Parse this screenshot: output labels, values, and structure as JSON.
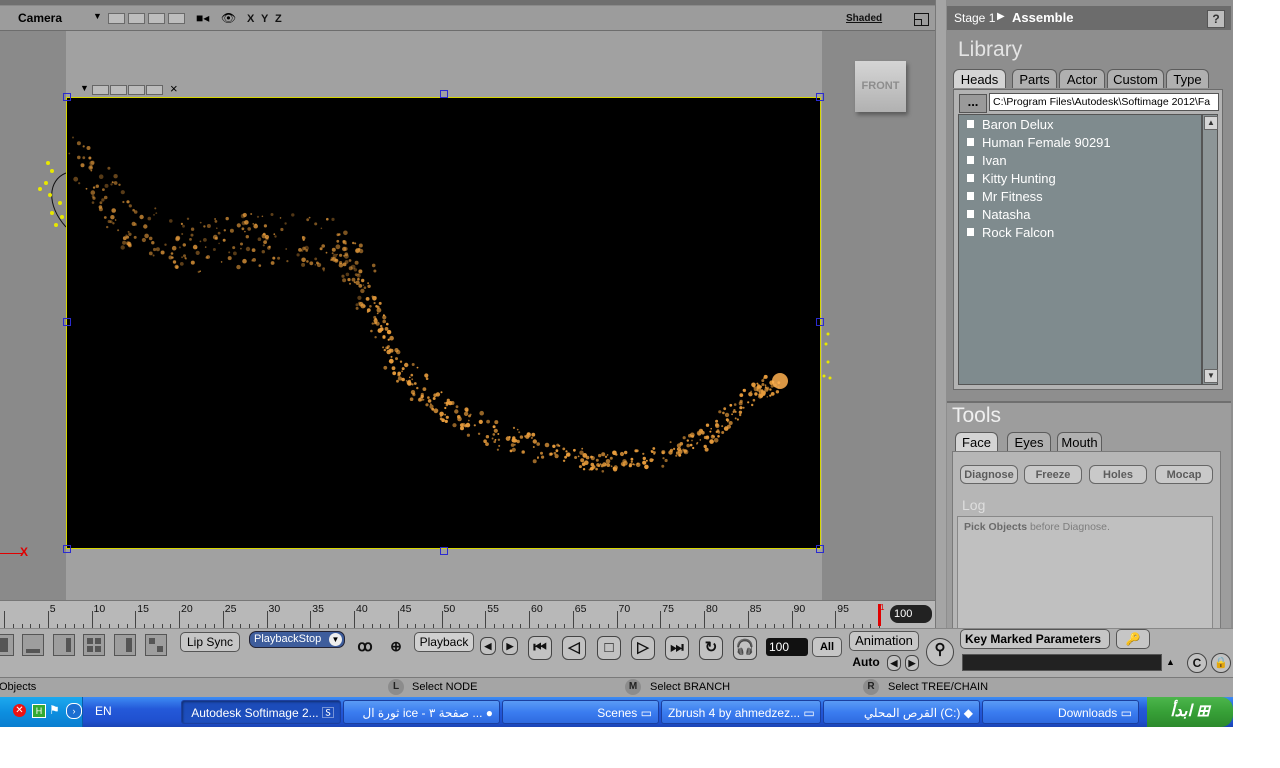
{
  "viewport": {
    "camera_label": "Camera",
    "axes": [
      "X",
      "Y",
      "Z"
    ],
    "display_mode": "Shaded",
    "front_label": "FRONT",
    "axis_x_label": "X"
  },
  "panel": {
    "stage": "Stage 1",
    "stage_name": "Assemble",
    "help": "?",
    "library_title": "Library",
    "library_tabs": [
      "Heads",
      "Parts",
      "Actor",
      "Custom",
      "Type"
    ],
    "path_button": "...",
    "path_value": "C:\\Program Files\\Autodesk\\Softimage 2012\\Fa",
    "characters": [
      "Baron Delux",
      "Human Female 90291",
      "Ivan",
      "Kitty Hunting",
      "Mr Fitness",
      "Natasha",
      "Rock Falcon"
    ],
    "tools_title": "Tools",
    "tools_tabs": [
      "Face",
      "Eyes",
      "Mouth"
    ],
    "tool_buttons": [
      "Diagnose",
      "Freeze",
      "Holes",
      "Mocap"
    ],
    "log_label": "Log",
    "log_bold": "Pick Objects",
    "log_text": " before Diagnose."
  },
  "timeline": {
    "labels": [
      "5",
      "10",
      "15",
      "20",
      "25",
      "30",
      "35",
      "40",
      "45",
      "50",
      "55",
      "60",
      "65",
      "70",
      "75",
      "80",
      "85",
      "90",
      "95"
    ],
    "current_frame": "1",
    "end_frame": "100"
  },
  "playback": {
    "lip_sync": "Lip Sync",
    "playback_stop": "PlaybackStop",
    "playback": "Playback",
    "fps": "100",
    "all": "All",
    "animation": "Animation",
    "auto": "Auto",
    "key_marked": "Key Marked Parameters"
  },
  "status": {
    "left": "Objects",
    "hints": [
      {
        "key": "L",
        "text": "Select NODE"
      },
      {
        "key": "M",
        "text": "Select BRANCH"
      },
      {
        "key": "R",
        "text": "Select TREE/CHAIN"
      }
    ]
  },
  "taskbar": {
    "lang": "EN",
    "items": [
      "Autodesk Softimage 2...",
      "ثورة ال ice - صفحة ٣ ...",
      "Scenes",
      "Zbrush 4 by ahmedzez...",
      "القرص المحلي (C:)",
      "Downloads"
    ],
    "start": "ابدأ"
  },
  "colors": {
    "accent": "#3e5d9c",
    "particles": "#e89c3c",
    "selection": "#d6d600",
    "taskbar": "#2459d9",
    "start": "#37a037"
  }
}
